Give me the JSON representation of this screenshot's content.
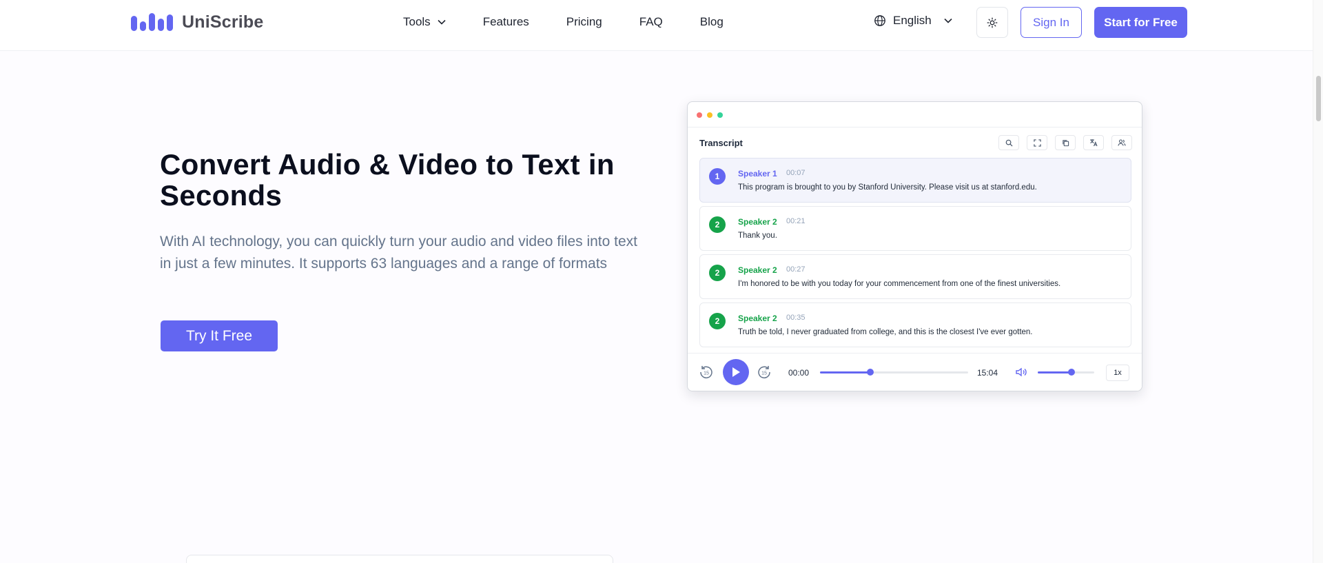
{
  "header": {
    "brand": "UniScribe",
    "nav": [
      "Tools",
      "Features",
      "Pricing",
      "FAQ",
      "Blog"
    ],
    "language": "English",
    "sign_in": "Sign In",
    "start": "Start for Free"
  },
  "hero": {
    "title": "Convert Audio & Video to Text in Seconds",
    "subtitle": "With AI technology, you can quickly turn your audio and video files into text in just a few minutes. It supports 63 languages and a range of formats",
    "cta": "Try It Free"
  },
  "transcript": {
    "heading": "Transcript",
    "entries": [
      {
        "num": "1",
        "speaker": "Speaker 1",
        "time": "00:07",
        "text": "This program is brought to you by Stanford University. Please visit us at stanford.edu.",
        "color": "#6366f1"
      },
      {
        "num": "2",
        "speaker": "Speaker 2",
        "time": "00:21",
        "text": "Thank you.",
        "color": "#16a34a"
      },
      {
        "num": "2",
        "speaker": "Speaker 2",
        "time": "00:27",
        "text": "I'm honored to be with you today for your commencement from one of the finest universities.",
        "color": "#16a34a"
      },
      {
        "num": "2",
        "speaker": "Speaker 2",
        "time": "00:35",
        "text": "Truth be told, I never graduated from college, and this is the closest I've ever gotten.",
        "color": "#16a34a"
      }
    ]
  },
  "player": {
    "current": "00:00",
    "duration": "15:04",
    "speed": "1x",
    "progress_fraction": 0.34,
    "volume_fraction": 0.6
  },
  "colors": {
    "accent": "#6366f1",
    "speaker2": "#16a34a"
  }
}
